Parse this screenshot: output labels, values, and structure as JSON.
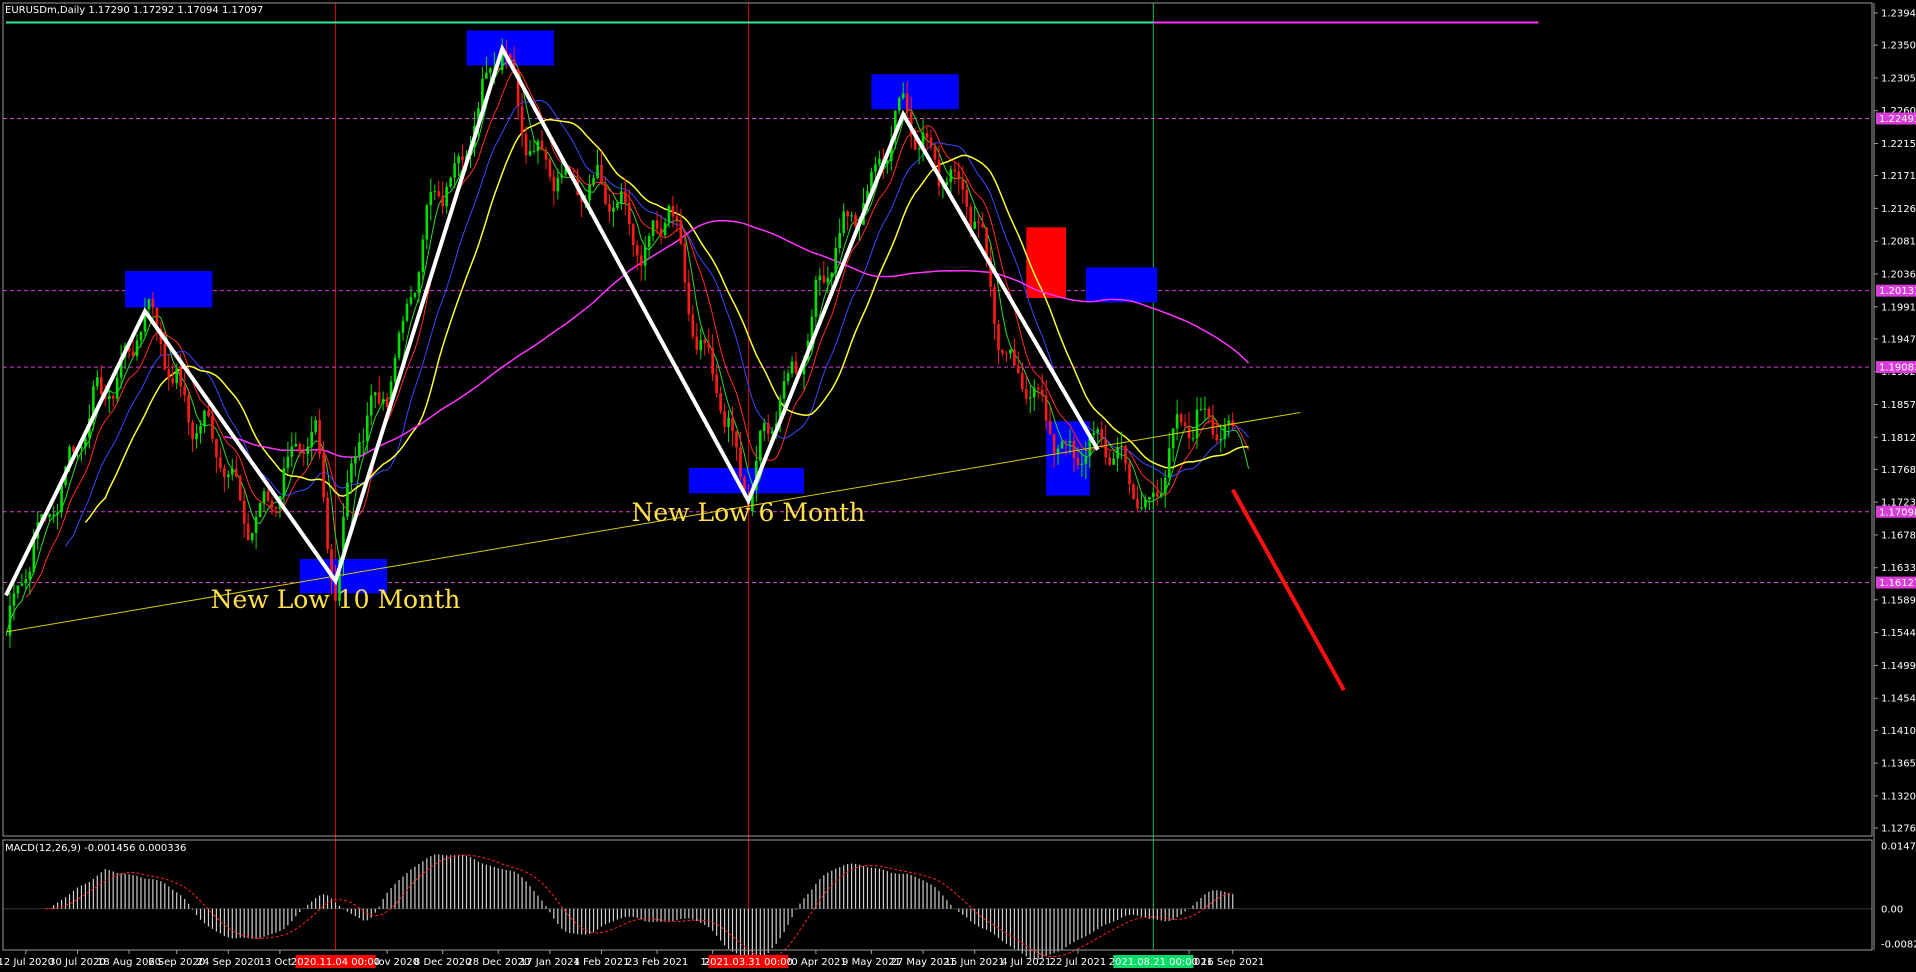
{
  "header": {
    "symbol_text": "EURUSDm,Daily  1.17290 1.17292 1.17094 1.17097",
    "macd_text": "MACD(12,26,9) -0.001456 0.000336"
  },
  "colors": {
    "background": "#000000",
    "bull": "#00dd00",
    "bear": "#ff1a1a",
    "ma_fast": "#2cd82c",
    "ma_mid": "#ff2a2a",
    "ma_slow": "#3848ff",
    "ma_yellow": "#ffff30",
    "ma_magenta": "#ff33ff",
    "zigzag": "#ffffff",
    "trendline": "#d8c800",
    "box_blue": "#0000ff",
    "box_red": "#ff0000",
    "top_line": "#2ee89a",
    "level_line": "#d93cd9",
    "forecast": "#ff1010"
  },
  "chart_data": [
    {
      "type": "candlestick",
      "title": "EURUSDm,Daily",
      "ohlc_last": {
        "open": 1.1729,
        "high": 1.17292,
        "low": 1.17094,
        "close": 1.17097
      },
      "ylim": [
        1.1265,
        1.2405
      ],
      "y_ticks": [
        "1.23940",
        "1.23500",
        "1.23050",
        "1.22600",
        "1.22150",
        "1.21710",
        "1.21260",
        "1.20810",
        "1.20360",
        "1.19910",
        "1.19470",
        "1.19020",
        "1.18570",
        "1.18120",
        "1.17680",
        "1.17230",
        "1.16780",
        "1.16330",
        "1.15890",
        "1.15440",
        "1.14990",
        "1.14540",
        "1.14100",
        "1.13650",
        "1.13200",
        "1.12760"
      ],
      "x_ticks": [
        {
          "label": "12 Jul 2020",
          "i": 5
        },
        {
          "label": "30 Jul 2020",
          "i": 18
        },
        {
          "label": "18 Aug 2020",
          "i": 31
        },
        {
          "label": "6 Sep 2020",
          "i": 43
        },
        {
          "label": "24 Sep 2020",
          "i": 56
        },
        {
          "label": "13 Oct 2",
          "i": 69
        },
        {
          "label": "19 Nov 2020",
          "i": 96
        },
        {
          "label": "8 Dec 2020",
          "i": 110
        },
        {
          "label": "28 Dec 2020",
          "i": 124
        },
        {
          "label": "17 Jan 2021",
          "i": 137
        },
        {
          "label": "4 Feb 2021",
          "i": 150
        },
        {
          "label": "23 Feb 2021",
          "i": 164
        },
        {
          "label": "14 M",
          "i": 178
        },
        {
          "label": "20 Apr 2021",
          "i": 204
        },
        {
          "label": "9 May 2021",
          "i": 218
        },
        {
          "label": "27 May 2021",
          "i": 231
        },
        {
          "label": "15 Jun 2021",
          "i": 244
        },
        {
          "label": "4 Jul 2021",
          "i": 257
        },
        {
          "label": "22 Jul 2021",
          "i": 270
        },
        {
          "label": "Aug 2021",
          "i": 298
        },
        {
          "label": "16 Sep 2021",
          "i": 309
        }
      ],
      "time_markers": [
        {
          "label": "2020.11.04 00:00",
          "i": 83,
          "color": "#ff0000"
        },
        {
          "label": "2021.03.31 00:00",
          "i": 187,
          "color": "#ff0000"
        },
        {
          "label": "2021.08.21 00:00",
          "i": 289,
          "color": "#00dd66"
        }
      ],
      "zigzag": [
        {
          "i": 0,
          "price": 1.1595
        },
        {
          "i": 35,
          "price": 1.1985
        },
        {
          "i": 83,
          "price": 1.1615
        },
        {
          "i": 125,
          "price": 1.2345
        },
        {
          "i": 187,
          "price": 1.1725
        },
        {
          "i": 226,
          "price": 1.2255
        },
        {
          "i": 275,
          "price": 1.1795
        }
      ],
      "forecast_line": [
        {
          "i": 309,
          "price": 1.174
        },
        {
          "i": 337,
          "price": 1.1465
        }
      ],
      "trendline": [
        {
          "i": 0,
          "price": 1.1545
        },
        {
          "i": 326,
          "price": 1.1846
        }
      ],
      "top_lines": [
        {
          "price": 1.2381,
          "from_i": 0,
          "to_i": 289,
          "color": "#2ee89a"
        },
        {
          "price": 1.2381,
          "from_i": 289,
          "to_i": 386,
          "color": "#ff33ff"
        }
      ],
      "level_lines": [
        {
          "price": 1.22493,
          "label": "1.22493"
        },
        {
          "price": 1.20131,
          "label": "1.20131"
        },
        {
          "price": 1.19083,
          "label": "1.19083"
        },
        {
          "price": 1.17098,
          "label": "1.17098"
        },
        {
          "price": 1.16127,
          "label": "1.16127"
        }
      ],
      "zones": [
        {
          "i0": 30,
          "i1": 52,
          "p0": 1.204,
          "p1": 1.199,
          "color": "#0000ff"
        },
        {
          "i0": 74,
          "i1": 96,
          "p0": 1.1645,
          "p1": 1.1598,
          "color": "#0000ff"
        },
        {
          "i0": 116,
          "i1": 138,
          "p0": 1.237,
          "p1": 1.2322,
          "color": "#0000ff"
        },
        {
          "i0": 172,
          "i1": 201,
          "p0": 1.177,
          "p1": 1.1735,
          "color": "#0000ff"
        },
        {
          "i0": 218,
          "i1": 240,
          "p0": 1.231,
          "p1": 1.2262,
          "color": "#0000ff"
        },
        {
          "i0": 257,
          "i1": 267,
          "p0": 1.21,
          "p1": 1.2003,
          "color": "#ff0000"
        },
        {
          "i0": 272,
          "i1": 290,
          "p0": 1.2045,
          "p1": 1.1997,
          "color": "#0000ff"
        },
        {
          "i0": 262,
          "i1": 273,
          "p0": 1.1834,
          "p1": 1.1732,
          "color": "#0000ff"
        }
      ],
      "annotations": [
        {
          "text": "New Low 10 Month",
          "i": 83,
          "price": 1.1578
        },
        {
          "text": "New Low 6 Month",
          "i": 187,
          "price": 1.1697
        }
      ],
      "subplot": {
        "type": "macd",
        "name": "MACD(12,26,9)",
        "macd": -0.001456,
        "signal": 0.000336,
        "ylim": [
          -0.008294,
          0.014769
        ],
        "y_ticks": [
          "0.014769",
          "0.00",
          "-0.008294"
        ]
      }
    }
  ]
}
